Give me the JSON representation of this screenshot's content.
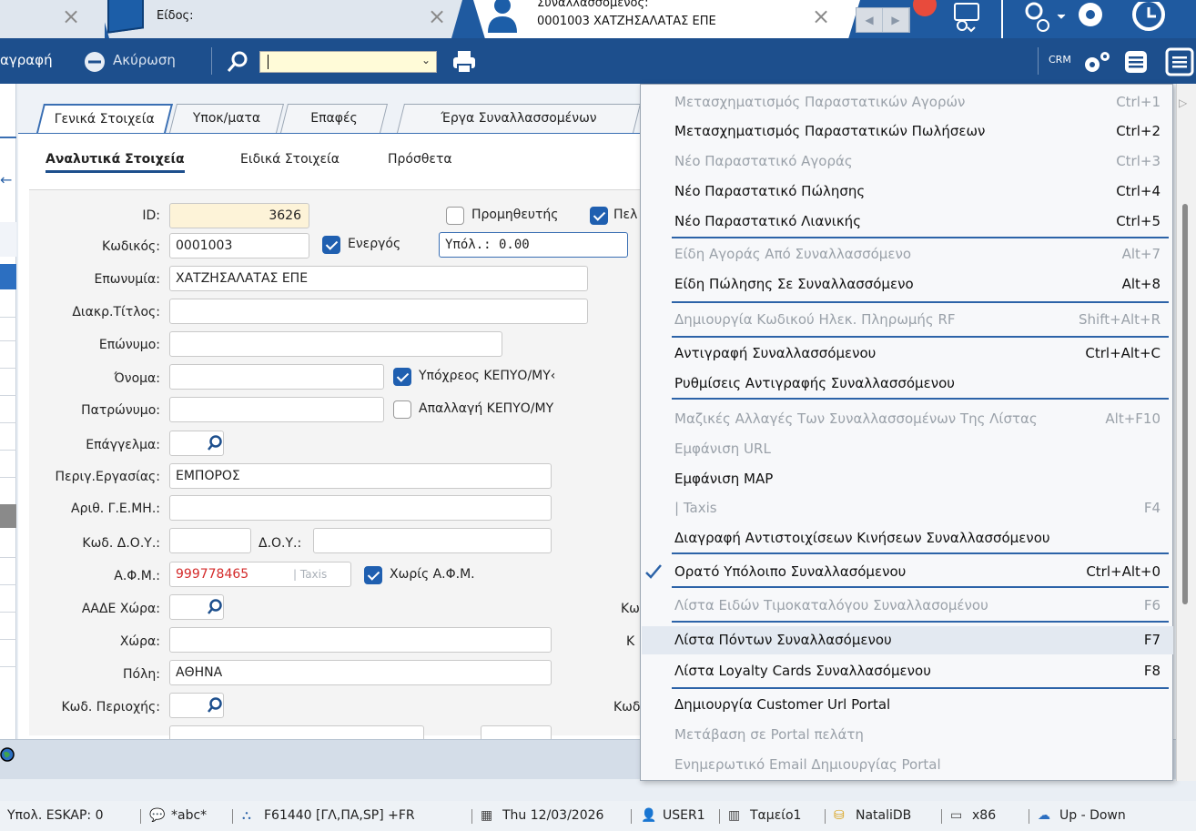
{
  "tabs": {
    "tab2_label": "Είδος:",
    "tab3_line1": "Συναλλασσόμενος:",
    "tab3_line2": "0001003  ΧΑΤΖΗΣΑΛΑΤΑΣ ΕΠΕ"
  },
  "toolbar": {
    "copy_label": "αγραφή",
    "cancel_label": "Ακύρωση",
    "crm_label": "CRM",
    "search_value": ""
  },
  "subtabs": [
    {
      "label": "Γενικά Στοιχεία"
    },
    {
      "label": "Υποκ/ματα"
    },
    {
      "label": "Επαφές"
    },
    {
      "label": "Έργα Συναλλασσομένων"
    }
  ],
  "sections": {
    "detail": "Αναλυτικά Στοιχεία",
    "special": "Ειδικά Στοιχεία",
    "extra": "Πρόσθετα"
  },
  "form": {
    "id_label": "ID:",
    "id_value": "3626",
    "supplier_label": "Προμηθευτής",
    "customer_label_partial": "Πελ",
    "code_label": "Κωδικός:",
    "code_value": "0001003",
    "active_label": "Ενεργός",
    "balance_value": "Υπόλ.: 0.00",
    "name_label": "Επωνυμία:",
    "name_value": "ΧΑΤΖΗΣΑΛΑΤΑΣ ΕΠΕ",
    "title_label": "Διακρ.Τίτλος:",
    "title_value": "",
    "surname_label": "Επώνυμο:",
    "surname_value": "",
    "firstname_label": "Όνομα:",
    "firstname_value": "",
    "kepyo_label": "Υπόχρεος ΚΕΠΥΟ/ΜΥ‹",
    "father_label": "Πατρώνυμο:",
    "father_value": "",
    "kepyo_exempt_label": "Απαλλαγή ΚΕΠΥΟ/ΜΥ",
    "profession_label": "Επάγγελμα:",
    "work_label": "Περιγ.Εργασίας:",
    "work_value": "ΕΜΠΟΡΟΣ",
    "gemi_label": "Αριθ. Γ.Ε.ΜΗ.:",
    "gemi_value": "",
    "doy_code_label": "Κωδ. Δ.Ο.Υ.:",
    "doy_code_value": "",
    "doy_label": "Δ.Ο.Υ.:",
    "doy_value": "",
    "afm_label": "Α.Φ.Μ.:",
    "afm_value": "999778465",
    "taxis_label": "| Taxis",
    "no_afm_label": "Χωρίς Α.Φ.Μ.",
    "aade_label": "ΑΑΔΕ Χώρα:",
    "country_label": "Χώρα:",
    "country_value": "",
    "city_label": "Πόλη:",
    "city_value": "ΑΘΗΝΑ",
    "area_code_label": "Κωδ. Περιοχής:",
    "right_col_1": "Κω",
    "right_col_2": "Κ",
    "right_col_3": "Κωδ"
  },
  "menu": [
    {
      "text": "Μετασχηματισμός Παραστατικών Αγορών",
      "key": "Ctrl+1",
      "disabled": true
    },
    {
      "text": "Μετασχηματισμός Παραστατικών Πωλήσεων",
      "key": "Ctrl+2",
      "disabled": false
    },
    {
      "text": "Νέο Παραστατικό Αγοράς",
      "key": "Ctrl+3",
      "disabled": true
    },
    {
      "text": "Νέο Παραστατικό Πώλησης",
      "key": "Ctrl+4",
      "disabled": false
    },
    {
      "text": "Νέο Παραστατικό Λιανικής",
      "key": "Ctrl+5",
      "disabled": false
    },
    {
      "text": "Είδη Αγοράς Από Συναλλασσόμενο",
      "key": "Alt+7",
      "disabled": true
    },
    {
      "text": "Είδη Πώλησης Σε Συναλλασσόμενο",
      "key": "Alt+8",
      "disabled": false
    },
    {
      "text": "Δημιουργία Κωδικού Ηλεκ. Πληρωμής RF",
      "key": "Shift+Alt+R",
      "disabled": true
    },
    {
      "text": "Αντιγραφή Συναλλασσόμενου",
      "key": "Ctrl+Alt+C",
      "disabled": false
    },
    {
      "text": "Ρυθμίσεις Αντιγραφής Συναλλασσόμενου",
      "key": "",
      "disabled": false
    },
    {
      "text": "Μαζικές Αλλαγές Των Συναλλασσομένων Της Λίστας",
      "key": "Alt+F10",
      "disabled": true
    },
    {
      "text": "Εμφάνιση URL",
      "key": "",
      "disabled": true
    },
    {
      "text": "Εμφάνιση MAP",
      "key": "",
      "disabled": false
    },
    {
      "text": "| Taxis",
      "key": "F4",
      "disabled": true
    },
    {
      "text": "Διαγραφή Αντιστοιχίσεων Κινήσεων Συναλλασσόμενου",
      "key": "",
      "disabled": false
    },
    {
      "text": "Ορατό Υπόλοιπο Συναλλασόμενου",
      "key": "Ctrl+Alt+0",
      "disabled": false,
      "checked": true
    },
    {
      "text": "Λίστα Ειδών Τιμοκαταλόγου Συναλλασομένου",
      "key": "F6",
      "disabled": true
    },
    {
      "text": "Λίστα Πόντων Συναλλασόμενου",
      "key": "F7",
      "disabled": false,
      "highlighted": true
    },
    {
      "text": "Λίστα Loyalty Cards Συναλλασόμενου",
      "key": "F8",
      "disabled": false
    },
    {
      "text": "Δημιουργία Customer Url Portal",
      "key": "",
      "disabled": false
    },
    {
      "text": "Μετάβαση σε Portal πελάτη",
      "key": "",
      "disabled": true
    },
    {
      "text": "Ενημερωτικό Email Δημιουργίας Portal",
      "key": "",
      "disabled": true
    }
  ],
  "status": {
    "eskap": "Υπολ. ESKAP: 0",
    "abc": "*abc*",
    "branch": "F61440 [ΓΛ,ΠΑ,SP] +FR",
    "date": "Thu 12/03/2026",
    "user": "USER1",
    "cashier": "Ταμείο1",
    "db": "NataliDB",
    "arch": "x86",
    "updown": "Up - Down"
  },
  "colors": {
    "accent": "#1d4f8d",
    "tabstrip": "#1f5aa0",
    "afm_red": "#d42a2a",
    "separator": "#2c63a8"
  }
}
